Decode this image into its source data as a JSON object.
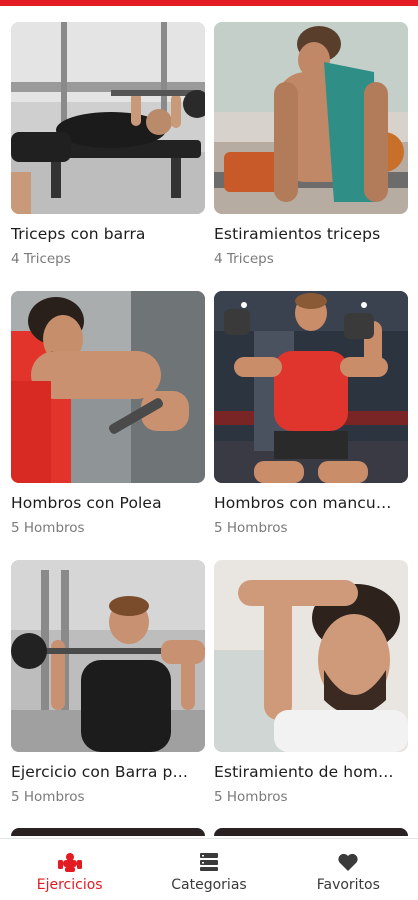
{
  "colors": {
    "accent": "#e31b23",
    "subtitle": "#7a7a7a"
  },
  "exercises": [
    {
      "title": "Triceps con barra",
      "subtitle": "4 Triceps",
      "image": "bench-press-photo"
    },
    {
      "title": "Estiramientos triceps",
      "subtitle": "4 Triceps",
      "image": "dips-photo"
    },
    {
      "title": "Hombros con Polea",
      "subtitle": "5 Hombros",
      "image": "cable-pulley-photo"
    },
    {
      "title": "Hombros con mancu…",
      "subtitle": "5 Hombros",
      "image": "dumbbell-press-photo"
    },
    {
      "title": "Ejercicio con Barra p…",
      "subtitle": "5 Hombros",
      "image": "barbell-press-photo"
    },
    {
      "title": "Estiramiento de hom…",
      "subtitle": "5 Hombros",
      "image": "shoulder-stretch-photo"
    }
  ],
  "nav": {
    "items": [
      {
        "label": "Ejercicios",
        "icon": "dumbbell-icon",
        "active": true
      },
      {
        "label": "Categorias",
        "icon": "list-icon",
        "active": false
      },
      {
        "label": "Favoritos",
        "icon": "heart-icon",
        "active": false
      }
    ]
  }
}
